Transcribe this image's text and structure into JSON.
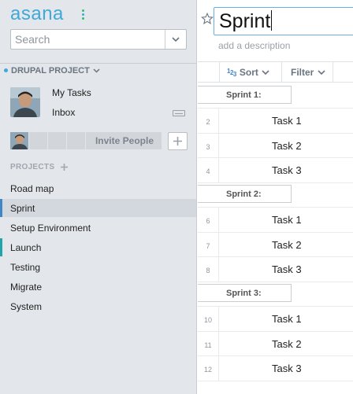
{
  "app": {
    "logo_text": "asana",
    "logo_dot_colors": [
      "#27c276",
      "#3fa9d8",
      "#27c276"
    ],
    "accent_color": "#3fa9d8"
  },
  "sidebar": {
    "search": {
      "placeholder": "Search",
      "value": ""
    },
    "workspace": {
      "label": "DRUPAL PROJECT"
    },
    "user_nav": [
      {
        "label": "My Tasks"
      },
      {
        "label": "Inbox"
      }
    ],
    "team": {
      "invite_label": "Invite People"
    },
    "projects_header": "PROJECTS",
    "projects": [
      {
        "label": "Road map",
        "active": false,
        "marker_color": ""
      },
      {
        "label": "Sprint",
        "active": true,
        "marker_color": "#3f86c7"
      },
      {
        "label": "Setup Environment",
        "active": false,
        "marker_color": ""
      },
      {
        "label": "Launch",
        "active": false,
        "marker_color": "#1fa4a8"
      },
      {
        "label": "Testing",
        "active": false,
        "marker_color": ""
      },
      {
        "label": "Migrate",
        "active": false,
        "marker_color": ""
      },
      {
        "label": "System",
        "active": false,
        "marker_color": ""
      }
    ]
  },
  "main": {
    "title": "Sprint",
    "description_placeholder": "add a description",
    "toolbar": {
      "sort_icon": "1 2 3",
      "sort_label": "Sort",
      "filter_label": "Filter"
    },
    "rows": [
      {
        "type": "section",
        "label": "Sprint 1:",
        "number": ""
      },
      {
        "type": "task",
        "label": "Task 1",
        "number": "2"
      },
      {
        "type": "task",
        "label": "Task 2",
        "number": "3"
      },
      {
        "type": "task",
        "label": "Task 3",
        "number": "4"
      },
      {
        "type": "section",
        "label": "Sprint 2:",
        "number": ""
      },
      {
        "type": "task",
        "label": "Task 1",
        "number": "6"
      },
      {
        "type": "task",
        "label": "Task 2",
        "number": "7"
      },
      {
        "type": "task",
        "label": "Task 3",
        "number": "8"
      },
      {
        "type": "section",
        "label": "Sprint 3:",
        "number": ""
      },
      {
        "type": "task",
        "label": "Task 1",
        "number": "10"
      },
      {
        "type": "task",
        "label": "Task 2",
        "number": "11"
      },
      {
        "type": "task",
        "label": "Task 3",
        "number": "12"
      }
    ]
  }
}
